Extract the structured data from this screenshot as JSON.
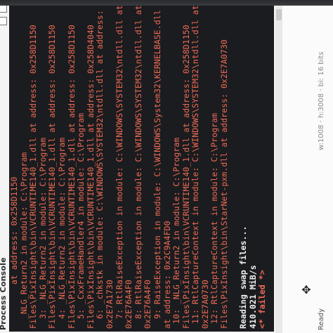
{
  "window": {
    "title": "Process Console",
    "status_ready": "Ready",
    "status_info": "w:1008 · h:3008 · bi: 16 bits"
  },
  "console": {
    "lines": [
      {
        "text": "         at address: 0x258D1150",
        "color": "orange"
      },
      {
        "text": "  _NLG_Return2 in module: C:\\Program",
        "color": "orange"
      },
      {
        "text": "Files\\PixInsight\\bin\\VCRUNTIME140_1.dll at address: 0x258D1150",
        "color": "orange"
      },
      {
        "text": "  3: _NLG_Return2 in module: C:\\Program",
        "color": "orange"
      },
      {
        "text": "Files\\PixInsight\\bin\\VCRUNTIME140_1.dll at address: 0x258D1150",
        "color": "orange"
      },
      {
        "text": "  4: _NLG_Return2 in module: C:\\Program",
        "color": "orange"
      },
      {
        "text": "Files\\PixInsight\\bin\\VCRUNTIME140_1.dll at address: 0x258D1150",
        "color": "orange"
      },
      {
        "text": "  5: _CxxFrameHandler4 in module: C:\\Program",
        "color": "orange"
      },
      {
        "text": "Files\\PixInsight\\bin\\VCRUNTIME140_1.dll at address: 0x258D4040",
        "color": "orange"
      },
      {
        "text": "  6: _chkstk in module: C:\\WINDOWS\\SYSTEM32\\ntdll.dll at address:",
        "color": "orange"
      },
      {
        "text": "0x2E7A1730",
        "color": "orange"
      },
      {
        "text": "  7: RtlRaiseException in module: C:\\WINDOWS\\SYSTEM32\\ntdll.dll at address:",
        "color": "orange"
      },
      {
        "text": "0x2E76A4F0",
        "color": "orange"
      },
      {
        "text": "  8: RtlRaiseException in module: C:\\WINDOWS\\SYSTEM32\\ntdll.dll at address:",
        "color": "orange"
      },
      {
        "text": "0x2E76A4F0",
        "color": "orange"
      },
      {
        "text": "  9: RaiseException in module: C:\\WINDOWS\\System32\\KERNELBASE.dll",
        "color": "orange"
      },
      {
        "text": "at address: 0x2C9A4FD0",
        "color": "orange"
      },
      {
        "text": " 10: _NLG_Return2 in module: C:\\Program",
        "color": "orange"
      },
      {
        "text": "Files\\PixInsight\\bin\\VCRUNTIME140_1.dll at address: 0x258D1150",
        "color": "orange"
      },
      {
        "text": " 11: RtlCaptureContext in module: C:\\WINDOWS\\SYSTEM32\\ntdll.dll at address:",
        "color": "orange"
      },
      {
        "text": "0x2E7A0730",
        "color": "orange"
      },
      {
        "text": " 12: RtlCaptureContext in module: C:\\Program",
        "color": "orange"
      },
      {
        "text": "Files\\PixInsight\\bin\\StarNet-pxm.dll at address: 0x2E7A0730",
        "color": "orange"
      },
      {
        "text": "",
        "color": "white"
      },
      {
        "text": "Reading swap files...",
        "color": "white"
      },
      {
        "text": "410.021 MiB/s",
        "color": "white"
      },
      {
        "text": "<* failed *>",
        "color": "orange"
      }
    ]
  },
  "colors": {
    "console_bg": "#1b1c1f",
    "error_text": "#ee6b55",
    "normal_text": "#f0f0f0"
  }
}
